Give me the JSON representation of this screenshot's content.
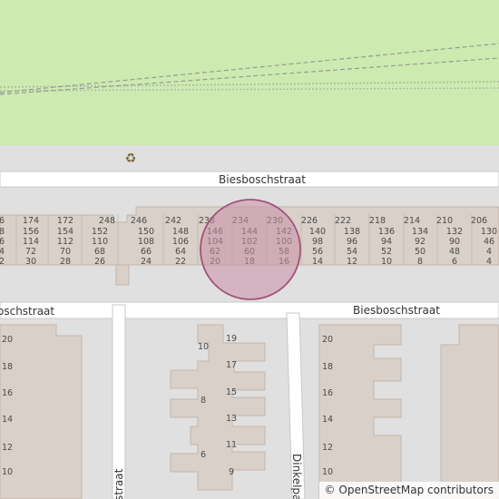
{
  "map": {
    "colors": {
      "park": "#cdebb0",
      "land": "#e0e0e0",
      "road": "#ffffff",
      "building": "#d9d0c9",
      "building_outline": "#c4b6ab",
      "marker_fill": "#c98fa6",
      "marker_stroke": "#a2537b",
      "rail": "#999999"
    },
    "streets": [
      {
        "id": "upper",
        "name": "Biesboschstraat"
      },
      {
        "id": "lower_left",
        "name": "oschstraat"
      },
      {
        "id": "lower_right",
        "name": "Biesboschstraat"
      },
      {
        "id": "vertical_left",
        "name": "straat"
      },
      {
        "id": "vertical_mid",
        "name": "Dinkelpa"
      }
    ],
    "recycling_icon": "recycling-icon",
    "location_marker": "location-circle",
    "house_number_rows": {
      "row1": [
        "6",
        "174",
        "172",
        "248",
        "246",
        "242",
        "238",
        "234",
        "230",
        "226",
        "222",
        "218",
        "214",
        "210",
        "206"
      ],
      "row2": [
        "8",
        "156",
        "154",
        "152",
        "150",
        "148",
        "146",
        "144",
        "142",
        "140",
        "138",
        "136",
        "134",
        "132",
        "130"
      ],
      "row3": [
        "6",
        "114",
        "112",
        "110",
        "108",
        "106",
        "104",
        "102",
        "100",
        "98",
        "96",
        "94",
        "92",
        "90",
        "46"
      ],
      "row4": [
        "4",
        "72",
        "70",
        "68",
        "66",
        "64",
        "62",
        "60",
        "58",
        "56",
        "54",
        "52",
        "50",
        "48",
        "4"
      ],
      "row5": [
        "2",
        "30",
        "28",
        "26",
        "24",
        "22",
        "20",
        "18",
        "16",
        "14",
        "12",
        "10",
        "8",
        "6",
        "4"
      ]
    },
    "left_block_numbers": [
      "20",
      "18",
      "16",
      "14",
      "12",
      "10"
    ],
    "mid_block_numbers": [
      "19",
      "10",
      "17",
      "15",
      "8",
      "13",
      "11",
      "6",
      "9"
    ],
    "right_block_numbers": [
      "20",
      "18",
      "16",
      "14",
      "12",
      "10"
    ]
  },
  "attribution": {
    "symbol": "©",
    "text": "OpenStreetMap contributors"
  }
}
